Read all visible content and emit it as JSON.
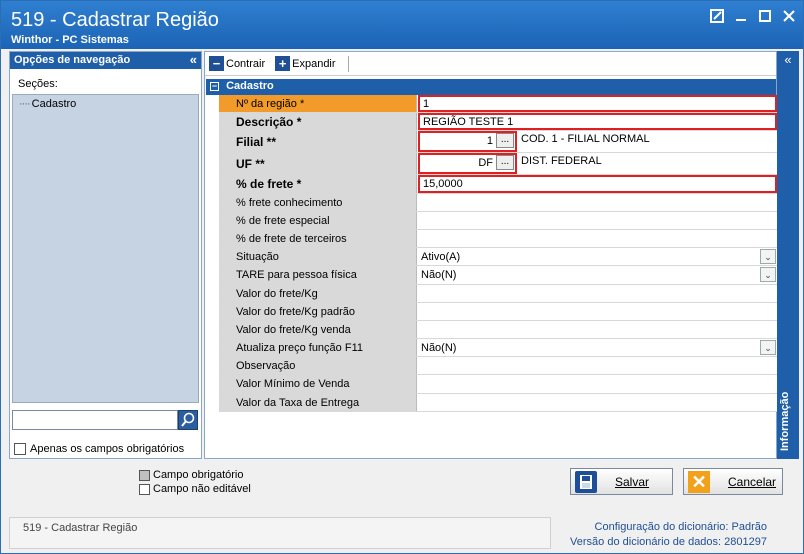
{
  "window": {
    "title": "519 - Cadastrar Região",
    "subtitle": "Winthor - PC Sistemas"
  },
  "nav": {
    "header": "Opções de navegação",
    "sections_label": "Seções:",
    "tree_item": "Cadastro",
    "only_required_label": "Apenas os campos obrigatórios"
  },
  "toolbar": {
    "collapse_label": "Contrair",
    "expand_label": "Expandir"
  },
  "section": {
    "title": "Cadastro"
  },
  "fields": [
    {
      "label": "Nº da região *",
      "value": "1"
    },
    {
      "label": "Descrição *",
      "value": "REGIÃO TESTE 1"
    },
    {
      "label": "Filial **",
      "code": "1",
      "desc": "COD. 1 - FILIAL NORMAL"
    },
    {
      "label": "UF **",
      "code": "DF",
      "desc": "DIST. FEDERAL"
    },
    {
      "label": "% de frete *",
      "value": "15,0000"
    },
    {
      "label": "% frete conhecimento",
      "value": ""
    },
    {
      "label": "% de frete especial",
      "value": ""
    },
    {
      "label": "% de frete de terceiros",
      "value": ""
    },
    {
      "label": "Situação",
      "value": "Ativo(A)"
    },
    {
      "label": "TARE para pessoa física",
      "value": "Não(N)"
    },
    {
      "label": "Valor do frete/Kg",
      "value": ""
    },
    {
      "label": "Valor do frete/Kg padrão",
      "value": ""
    },
    {
      "label": "Valor do frete/Kg venda",
      "value": ""
    },
    {
      "label": "Atualiza preço função F11",
      "value": "Não(N)"
    },
    {
      "label": "Observação",
      "value": ""
    },
    {
      "label": "Valor Mínimo de Venda",
      "value": ""
    },
    {
      "label": "Valor da Taxa de Entrega",
      "value": ""
    }
  ],
  "ellipsis": "...",
  "info_panel": {
    "label": "Informação"
  },
  "legend": {
    "required": "Campo obrigatório",
    "not_editable": "Campo não editável"
  },
  "buttons": {
    "save": "Salvar",
    "cancel": "Cancelar"
  },
  "statusbar": {
    "left": "519 - Cadastrar Região",
    "dict_config_label": "Configuração do dicionário:",
    "dict_config_value": "Padrão",
    "dict_version_label": "Versão do dicionário de dados:",
    "dict_version_value": "2801297"
  }
}
